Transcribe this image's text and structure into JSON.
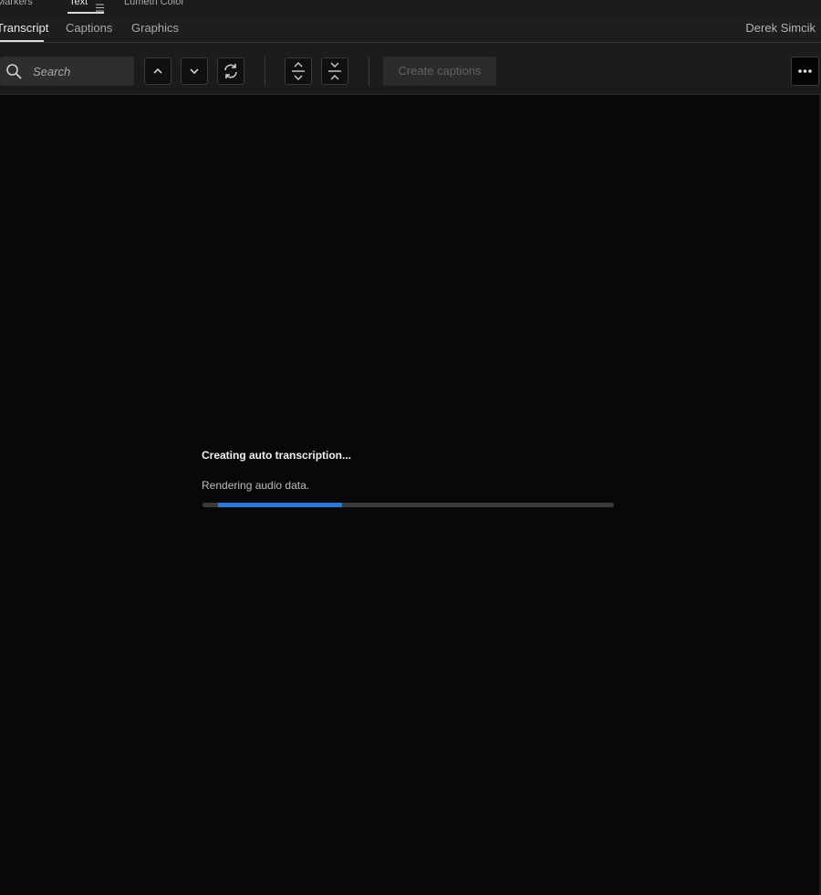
{
  "panel_tabs": {
    "markers": "Markers",
    "text": "Text",
    "lumetri": "Lumetri Color"
  },
  "sub_tabs": {
    "transcript": "Transcript",
    "captions": "Captions",
    "graphics": "Graphics"
  },
  "user": {
    "name": "Derek Simcik"
  },
  "toolbar": {
    "search_placeholder": "Search",
    "create_captions_label": "Create captions",
    "icons": [
      "search-icon",
      "chevron-up-icon",
      "chevron-down-icon",
      "refresh-icon",
      "expand-icon",
      "collapse-icon",
      "more-icon"
    ]
  },
  "progress": {
    "title": "Creating auto transcription...",
    "status": "Rendering audio data.",
    "fill_start_fraction": 0.038,
    "fill_end_fraction": 0.34
  },
  "colors": {
    "accent": "#2a78d6",
    "background": "#080808",
    "panel": "#1c1c1c"
  }
}
